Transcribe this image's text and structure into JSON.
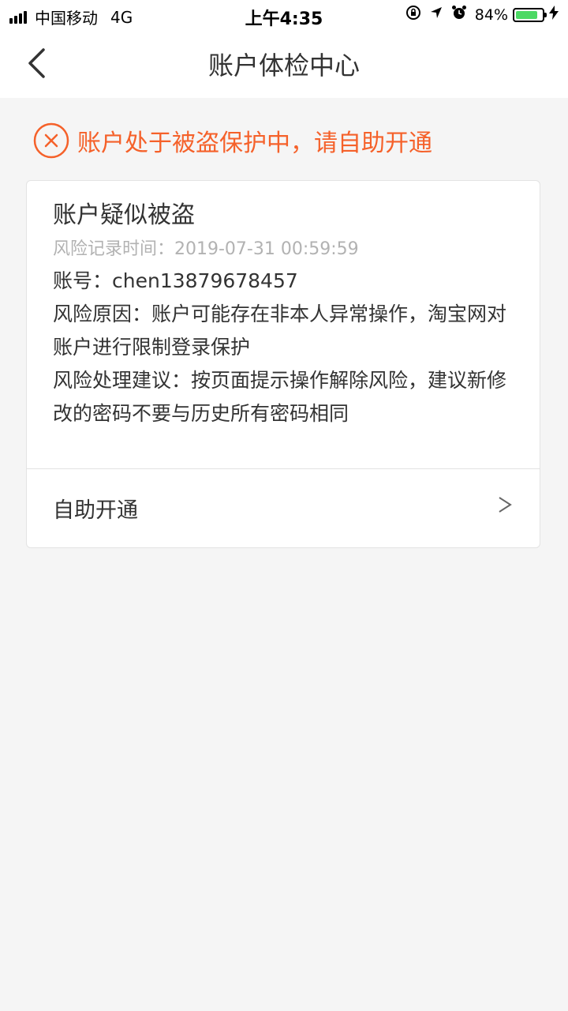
{
  "status_bar": {
    "carrier": "中国移动",
    "network": "4G",
    "time": "上午4:35",
    "battery_percent": "84%",
    "battery_level": 0.84,
    "icons": [
      "rotation-lock-icon",
      "location-icon",
      "alarm-icon",
      "battery-icon",
      "charging-icon"
    ]
  },
  "nav": {
    "title": "账户体检中心",
    "back_icon": "chevron-left-icon"
  },
  "warning": {
    "icon": "circle-x-icon",
    "text": "账户处于被盗保护中，请自助开通",
    "color": "#f5612a"
  },
  "card": {
    "title": "账户疑似被盗",
    "risk_time": "风险记录时间：2019-07-31 00:59:59",
    "account": "账号：chen13879678457",
    "reason": "风险原因：账户可能存在非本人异常操作，淘宝网对账户进行限制登录保护",
    "suggestion": "风险处理建议：按页面提示操作解除风险，建议新修改的密码不要与历史所有密码相同",
    "action_label": "自助开通",
    "action_icon": "chevron-right-icon"
  }
}
